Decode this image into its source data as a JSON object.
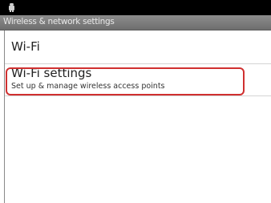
{
  "status_bar": {
    "icon": "android-icon"
  },
  "title_bar": {
    "title": "Wireless & network settings"
  },
  "settings_list": {
    "items": [
      {
        "label": "Wi-Fi"
      },
      {
        "label": "Wi-Fi settings",
        "summary": "Set up & manage wireless access points"
      }
    ]
  },
  "colors": {
    "highlight": "#d03030",
    "title_bar": "#7a7a7a"
  }
}
